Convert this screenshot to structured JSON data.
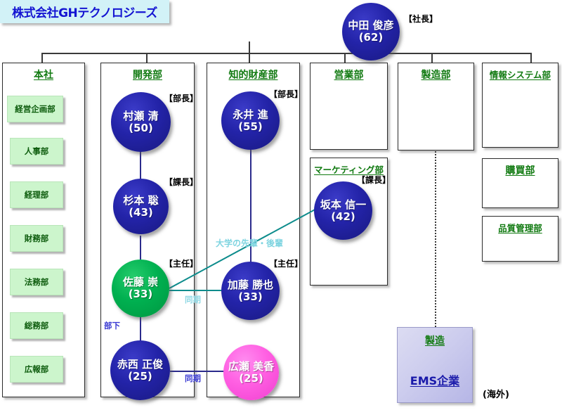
{
  "company": {
    "banner": "株式会社GHテクノロジーズ"
  },
  "ceo": {
    "name": "中田 俊彦",
    "age": "(62)",
    "role": "【社長】",
    "color": "#2323a8"
  },
  "departments": [
    {
      "id": "honsha",
      "title": "本社",
      "sub_departments": [
        "経営企画部",
        "人事部",
        "経理部",
        "財務部",
        "法務部",
        "総務部",
        "広報部"
      ]
    },
    {
      "id": "kaihatsu",
      "title": "開発部",
      "people": [
        {
          "name": "村瀬 清",
          "age": "(50)",
          "role": "【部長】",
          "color": "blue"
        },
        {
          "name": "杉本 聡",
          "age": "(43)",
          "role": "【課長】",
          "color": "blue"
        },
        {
          "name": "佐藤 崇",
          "age": "(33)",
          "role": "【主任】",
          "color": "green"
        },
        {
          "name": "赤西 正俊",
          "age": "(25)",
          "role": "",
          "color": "blue"
        }
      ]
    },
    {
      "id": "chizai",
      "title": "知的財産部",
      "people": [
        {
          "name": "永井 進",
          "age": "(55)",
          "role": "【部長】",
          "color": "blue"
        },
        {
          "name": "加藤 勝也",
          "age": "(33)",
          "role": "【主任】",
          "color": "blue"
        },
        {
          "name": "広瀬 美香",
          "age": "(25)",
          "role": "",
          "color": "pink"
        }
      ]
    },
    {
      "id": "eigyo",
      "title": "営業部",
      "people": []
    },
    {
      "id": "seizo",
      "title": "製造部",
      "people": []
    },
    {
      "id": "johosystem",
      "title": "情報システム部",
      "people": []
    }
  ],
  "marketing": {
    "title": "マーケティング部",
    "person": {
      "name": "坂本 信一",
      "age": "(42)",
      "role": "【課長】",
      "color": "blue"
    }
  },
  "side_departments": [
    {
      "title": "購買部"
    },
    {
      "title": "品質管理部"
    }
  ],
  "relations": {
    "senpai_kohai": "大学の先輩・後輩",
    "douki_upper": "同期",
    "douki_lower": "同期",
    "buka": "部下"
  },
  "ems": {
    "heading": "製造",
    "name": "EMS企業",
    "note": "(海外)"
  },
  "colors": {
    "banner_bg": "#d2f2f7",
    "banner_text": "#1414d2",
    "dept_title": "#117a11",
    "chip_bg": "#ccf5cc",
    "chip_text": "#0d5c0d",
    "blue_circle": "#2323a8",
    "green_circle": "#00b050",
    "pink_circle": "#ff5fe2",
    "relation_teal": "#0d8c8c",
    "relation_line_blue": "#2b2b8c"
  }
}
